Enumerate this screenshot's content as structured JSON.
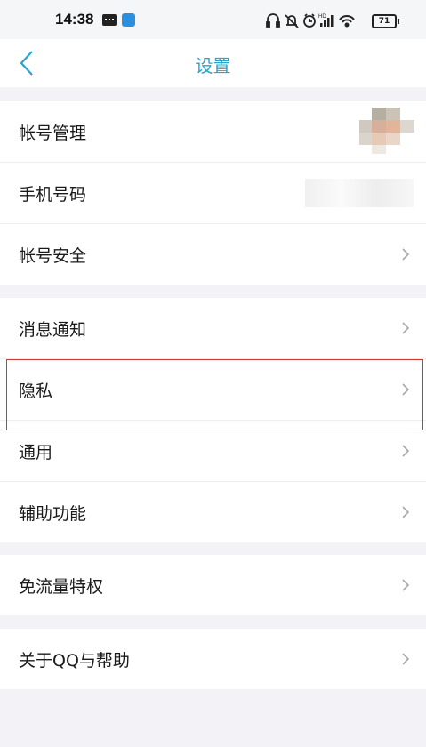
{
  "status_bar": {
    "time": "14:38",
    "battery": "71",
    "icons": [
      "headset-icon",
      "mute-icon",
      "alarm-icon",
      "signal-icon",
      "wifi-icon",
      "battery-icon"
    ]
  },
  "nav": {
    "title": "设置",
    "back_icon": "chevron-left-icon",
    "accent_color": "#2aa4cf"
  },
  "groups": [
    {
      "items": [
        {
          "label": "帐号管理",
          "trailing": "blurred-avatar"
        },
        {
          "label": "手机号码",
          "trailing": "blurred-phone"
        },
        {
          "label": "帐号安全",
          "trailing": "chevron"
        }
      ]
    },
    {
      "items": [
        {
          "label": "消息通知",
          "trailing": "chevron"
        },
        {
          "label": "隐私",
          "trailing": "chevron",
          "highlighted": true
        },
        {
          "label": "通用",
          "trailing": "chevron"
        },
        {
          "label": "辅助功能",
          "trailing": "chevron"
        }
      ]
    },
    {
      "items": [
        {
          "label": "免流量特权",
          "trailing": "chevron"
        }
      ]
    },
    {
      "items": [
        {
          "label": "关于QQ与帮助",
          "trailing": "chevron"
        }
      ]
    }
  ],
  "highlight_color": "#cc3b33"
}
